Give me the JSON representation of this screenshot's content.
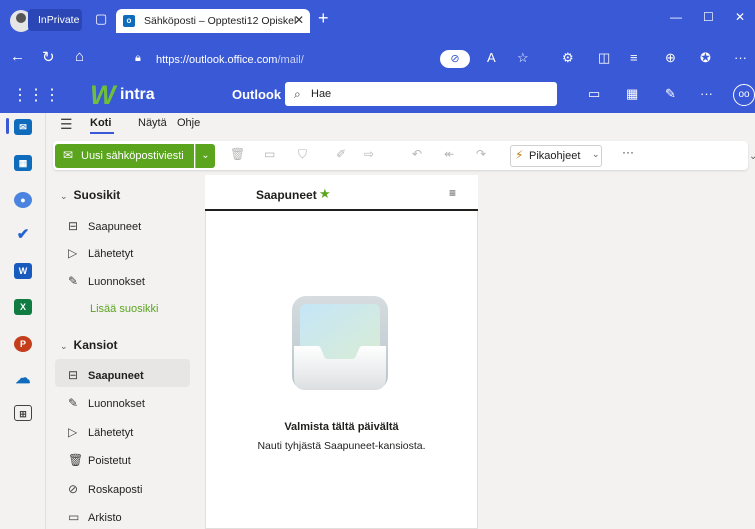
{
  "browser": {
    "profile_label": "InPrivate",
    "tab_title": "Sähköposti – Opptesti12 Opiskel",
    "tab_favicon": "o",
    "url_host": "https://outlook.office.com",
    "url_path": "/mail/",
    "new_tab": "+"
  },
  "header": {
    "logo_mark": "W",
    "logo_text": "intra",
    "app_name": "Outlook",
    "search_placeholder": "Hae",
    "avatar_text": "oo"
  },
  "ribbon": {
    "tabs": [
      "Koti",
      "Näytä",
      "Ohje"
    ],
    "active_tab": "Koti",
    "new_mail_label": "Uusi sähköpostiviesti",
    "quick_steps_label": "Pikaohjeet",
    "more_label": "···"
  },
  "folders": {
    "favorites_header": "Suosikit",
    "favorites": [
      {
        "label": "Saapuneet",
        "icon": "inbox-icon"
      },
      {
        "label": "Lähetetyt",
        "icon": "send-icon"
      },
      {
        "label": "Luonnokset",
        "icon": "pencil-icon"
      }
    ],
    "add_favorite": "Lisää suosikki",
    "folders_header": "Kansiot",
    "items": [
      {
        "label": "Saapuneet",
        "icon": "inbox-icon",
        "selected": true
      },
      {
        "label": "Luonnokset",
        "icon": "pencil-icon"
      },
      {
        "label": "Lähetetyt",
        "icon": "send-icon"
      },
      {
        "label": "Poistetut",
        "icon": "trash-icon"
      },
      {
        "label": "Roskaposti",
        "icon": "junk-icon"
      },
      {
        "label": "Arkisto",
        "icon": "archive-icon"
      }
    ]
  },
  "message_list": {
    "title": "Saapuneet",
    "empty_title": "Valmista tältä päivältä",
    "empty_subtitle": "Nauti tyhjästä Saapuneet-kansiosta."
  },
  "colors": {
    "brand_blue": "#3a59d6",
    "accent_green": "#5ba41e"
  }
}
